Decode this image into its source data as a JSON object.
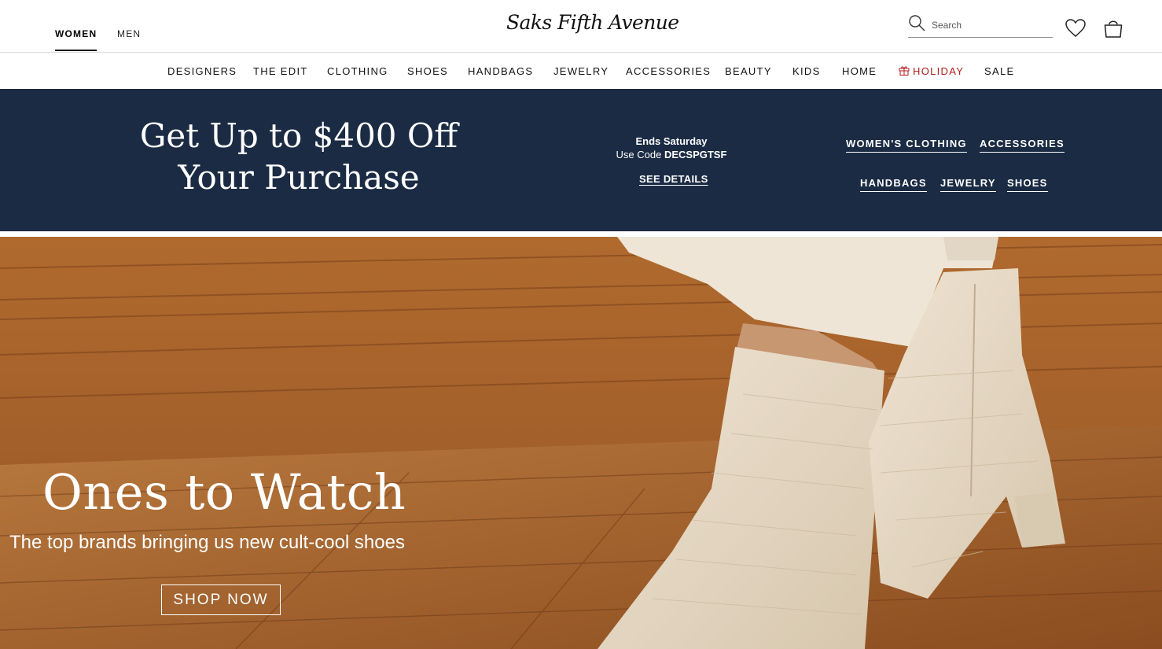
{
  "header": {
    "tabs": [
      {
        "label": "WOMEN",
        "active": true
      },
      {
        "label": "MEN",
        "active": false
      }
    ],
    "logo_text": "Saks Fifth Avenue",
    "search": {
      "placeholder": "Search",
      "icon": "search-icon"
    },
    "icons": [
      "heart-icon",
      "shopping-bag-icon"
    ]
  },
  "nav": {
    "items": [
      {
        "label": "DESIGNERS"
      },
      {
        "label": "THE EDIT"
      },
      {
        "label": "CLOTHING"
      },
      {
        "label": "SHOES"
      },
      {
        "label": "HANDBAGS"
      },
      {
        "label": "JEWELRY"
      },
      {
        "label": "ACCESSORIES"
      },
      {
        "label": "BEAUTY"
      },
      {
        "label": "KIDS"
      },
      {
        "label": "HOME"
      },
      {
        "label": "HOLIDAY",
        "icon": "gift-icon",
        "color": "#b01d1d"
      },
      {
        "label": "SALE"
      }
    ]
  },
  "promo": {
    "headline_line1": "Get Up to $400 Off",
    "headline_line2": "Your Purchase",
    "ends": "Ends Saturday",
    "code_prefix": "Use Code ",
    "code": "DECSPGTSF",
    "details_link": "SEE DETAILS",
    "links": [
      {
        "label": "WOMEN'S CLOTHING"
      },
      {
        "label": "ACCESSORIES"
      },
      {
        "label": "HANDBAGS"
      },
      {
        "label": "JEWELRY"
      },
      {
        "label": "SHOES"
      }
    ],
    "background_color": "#1b2b44"
  },
  "hero": {
    "title": "Ones to Watch",
    "subtitle": "The top brands bringing us new cult-cool shoes",
    "button_label": "SHOP NOW"
  }
}
